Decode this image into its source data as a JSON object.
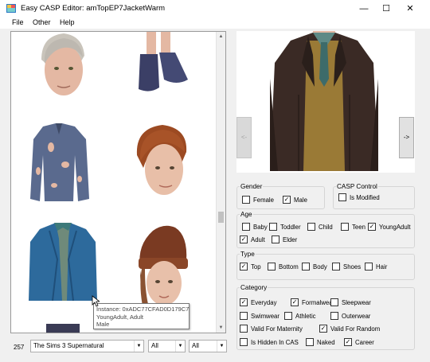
{
  "window": {
    "title": "Easy CASP Editor: amTopEP7JacketWarm",
    "minimize_icon": "—",
    "maximize_icon": "☐",
    "close_icon": "✕"
  },
  "menu": {
    "file": "File",
    "other": "Other",
    "help": "Help"
  },
  "tooltip": {
    "line1": "Instance: 0xADC77CFAD0D179C7",
    "line2": "YoungAdult, Adult",
    "line3": "Male"
  },
  "footer": {
    "count": "257",
    "pack": "The Sims 3 Supernatural",
    "filter1": "All",
    "filter2": "All"
  },
  "preview": {
    "prev_label": "<-",
    "next_label": "->"
  },
  "gender": {
    "legend": "Gender",
    "female": {
      "label": "Female",
      "checked": false
    },
    "male": {
      "label": "Male",
      "checked": true
    }
  },
  "casp_control": {
    "legend": "CASP Control",
    "is_modified": {
      "label": "Is Modified",
      "checked": false
    }
  },
  "age": {
    "legend": "Age",
    "baby": {
      "label": "Baby",
      "checked": false
    },
    "toddler": {
      "label": "Toddler",
      "checked": false
    },
    "child": {
      "label": "Child",
      "checked": false
    },
    "teen": {
      "label": "Teen",
      "checked": false
    },
    "youngadult": {
      "label": "YoungAdult",
      "checked": true
    },
    "adult": {
      "label": "Adult",
      "checked": true
    },
    "elder": {
      "label": "Elder",
      "checked": false
    }
  },
  "type": {
    "legend": "Type",
    "top": {
      "label": "Top",
      "checked": true
    },
    "bottom": {
      "label": "Bottom",
      "checked": false
    },
    "body": {
      "label": "Body",
      "checked": false
    },
    "shoes": {
      "label": "Shoes",
      "checked": false
    },
    "hair": {
      "label": "Hair",
      "checked": false
    }
  },
  "category": {
    "legend": "Category",
    "everyday": {
      "label": "Everyday",
      "checked": true
    },
    "formalwear": {
      "label": "Formalwear",
      "checked": true
    },
    "sleepwear": {
      "label": "Sleepwear",
      "checked": false
    },
    "swimwear": {
      "label": "Swimwear",
      "checked": false
    },
    "athletic": {
      "label": "Athletic",
      "checked": false
    },
    "outerwear": {
      "label": "Outerwear",
      "checked": false
    },
    "valid_for_maternity": {
      "label": "Valid For Maternity",
      "checked": false
    },
    "valid_for_random": {
      "label": "Valid For Random",
      "checked": true
    },
    "is_hidden_in_cas": {
      "label": "Is Hidden In CAS",
      "checked": false
    },
    "naked": {
      "label": "Naked",
      "checked": false
    },
    "career": {
      "label": "Career",
      "checked": true
    }
  }
}
